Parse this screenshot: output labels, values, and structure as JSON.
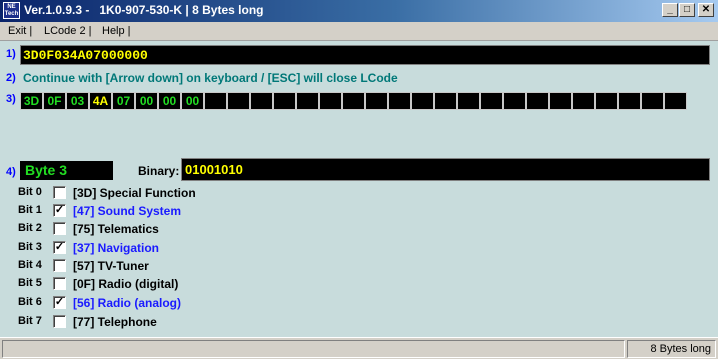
{
  "window": {
    "title": "Ver.1.0.9.3 -   1K0-907-530-K | 8 Bytes long",
    "logo_text": "NE Tech",
    "minimize": "_",
    "maximize": "□",
    "close": "✕"
  },
  "menu": {
    "items": [
      "Exit |",
      "LCode 2 |",
      "Help |"
    ]
  },
  "sections": {
    "n1": "1)",
    "n2": "2)",
    "n3": "3)",
    "n4": "4)"
  },
  "code_value": "3D0F034A07000000",
  "hint": "Continue with [Arrow down] on keyboard / [ESC] will close LCode",
  "bytes": [
    "3D",
    "0F",
    "03",
    "4A",
    "07",
    "00",
    "00",
    "00",
    "",
    "",
    "",
    "",
    "",
    "",
    "",
    "",
    "",
    "",
    "",
    "",
    "",
    "",
    "",
    "",
    "",
    "",
    "",
    "",
    ""
  ],
  "selected_byte_index": 3,
  "byte_label": "Byte 3",
  "binary_label": "Binary:",
  "binary_value": "01001010",
  "bits": [
    {
      "label": "Bit 0",
      "checked": false,
      "mark": "",
      "text": "[3D] Special Function"
    },
    {
      "label": "Bit 1",
      "checked": true,
      "mark": "✓",
      "text": "[47] Sound System"
    },
    {
      "label": "Bit 2",
      "checked": false,
      "mark": "",
      "text": "[75] Telematics"
    },
    {
      "label": "Bit 3",
      "checked": true,
      "mark": "✓",
      "text": "[37] Navigation"
    },
    {
      "label": "Bit 4",
      "checked": false,
      "mark": "",
      "text": "[57] TV-Tuner"
    },
    {
      "label": "Bit 5",
      "checked": false,
      "mark": "",
      "text": "[0F] Radio (digital)"
    },
    {
      "label": "Bit 6",
      "checked": true,
      "mark": "✓",
      "text": "[56] Radio (analog)"
    },
    {
      "label": "Bit 7",
      "checked": false,
      "mark": "",
      "text": "[77] Telephone"
    }
  ],
  "status": {
    "left": "",
    "right": "8 Bytes long"
  },
  "colors": {
    "field_bg": "#000000",
    "yellow": "#ffff00",
    "green": "#22dd22",
    "checked_text": "#1a1aff",
    "client_bg": "#c8dcdc"
  }
}
